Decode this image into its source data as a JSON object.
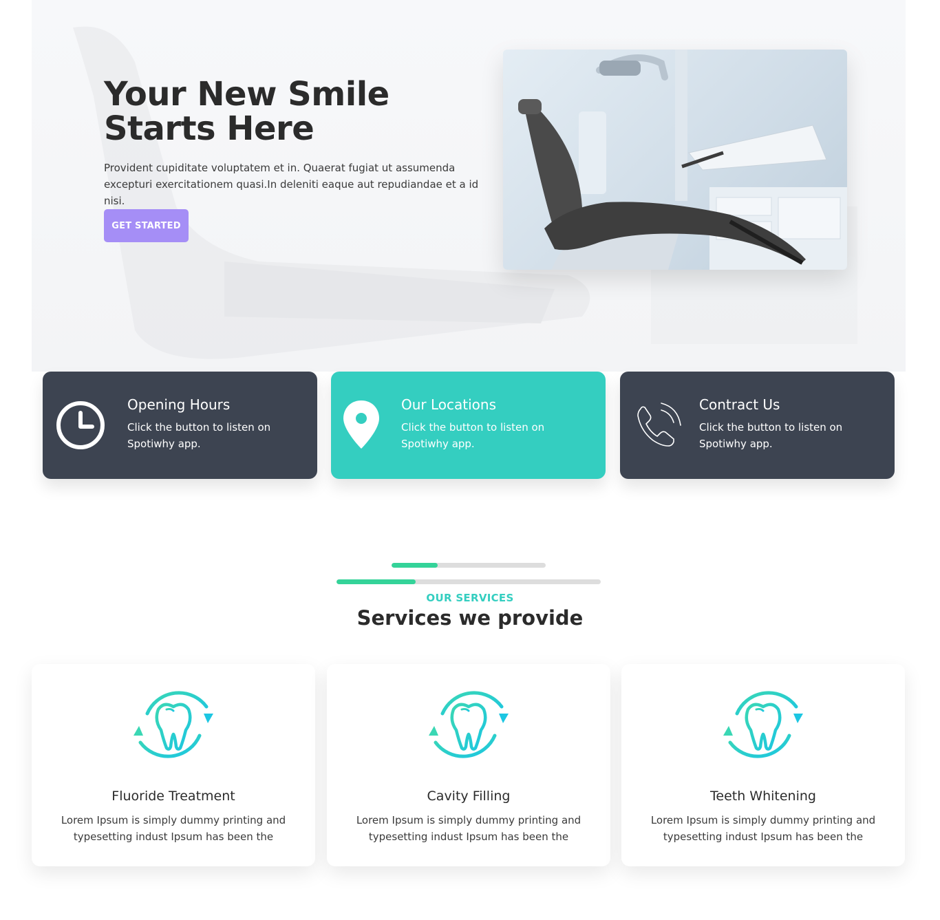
{
  "hero": {
    "title": "Your New Smile Starts Here",
    "text": "Provident cupiditate voluptatem et in. Quaerat fugiat ut assumenda excepturi exercitationem quasi.In deleniti eaque aut repudiandae et a id nisi.",
    "button_label": "GET STARTED",
    "image": "dental-chair-photo"
  },
  "info_cards": [
    {
      "icon": "clock-icon",
      "title": "Opening Hours",
      "text": "Click the button to listen on Spotiwhy app.",
      "color": "#3d4451"
    },
    {
      "icon": "map-pin-icon",
      "title": "Our Locations",
      "text": "Click the button to listen on Spotiwhy app.",
      "color": "#34cec0"
    },
    {
      "icon": "phone-icon",
      "title": "Contract Us",
      "text": "Click the button to listen on Spotiwhy app.",
      "color": "#3d4451"
    }
  ],
  "services": {
    "eyebrow": "OUR SERVICES",
    "title": "Services we provide",
    "items": [
      {
        "icon": "tooth-cycle-icon",
        "title": "Fluoride Treatment",
        "text": "Lorem Ipsum is simply dummy printing and typesetting indust Ipsum has been the"
      },
      {
        "icon": "tooth-cycle-icon",
        "title": "Cavity Filling",
        "text": "Lorem Ipsum is simply dummy printing and typesetting indust Ipsum has been the"
      },
      {
        "icon": "tooth-cycle-icon",
        "title": "Teeth Whitening",
        "text": "Lorem Ipsum is simply dummy printing and typesetting indust Ipsum has been the"
      }
    ]
  },
  "colors": {
    "accent_purple": "#a58ef6",
    "accent_teal": "#34cec0",
    "dark_card": "#3d4451",
    "progress_green": "#34d399"
  }
}
